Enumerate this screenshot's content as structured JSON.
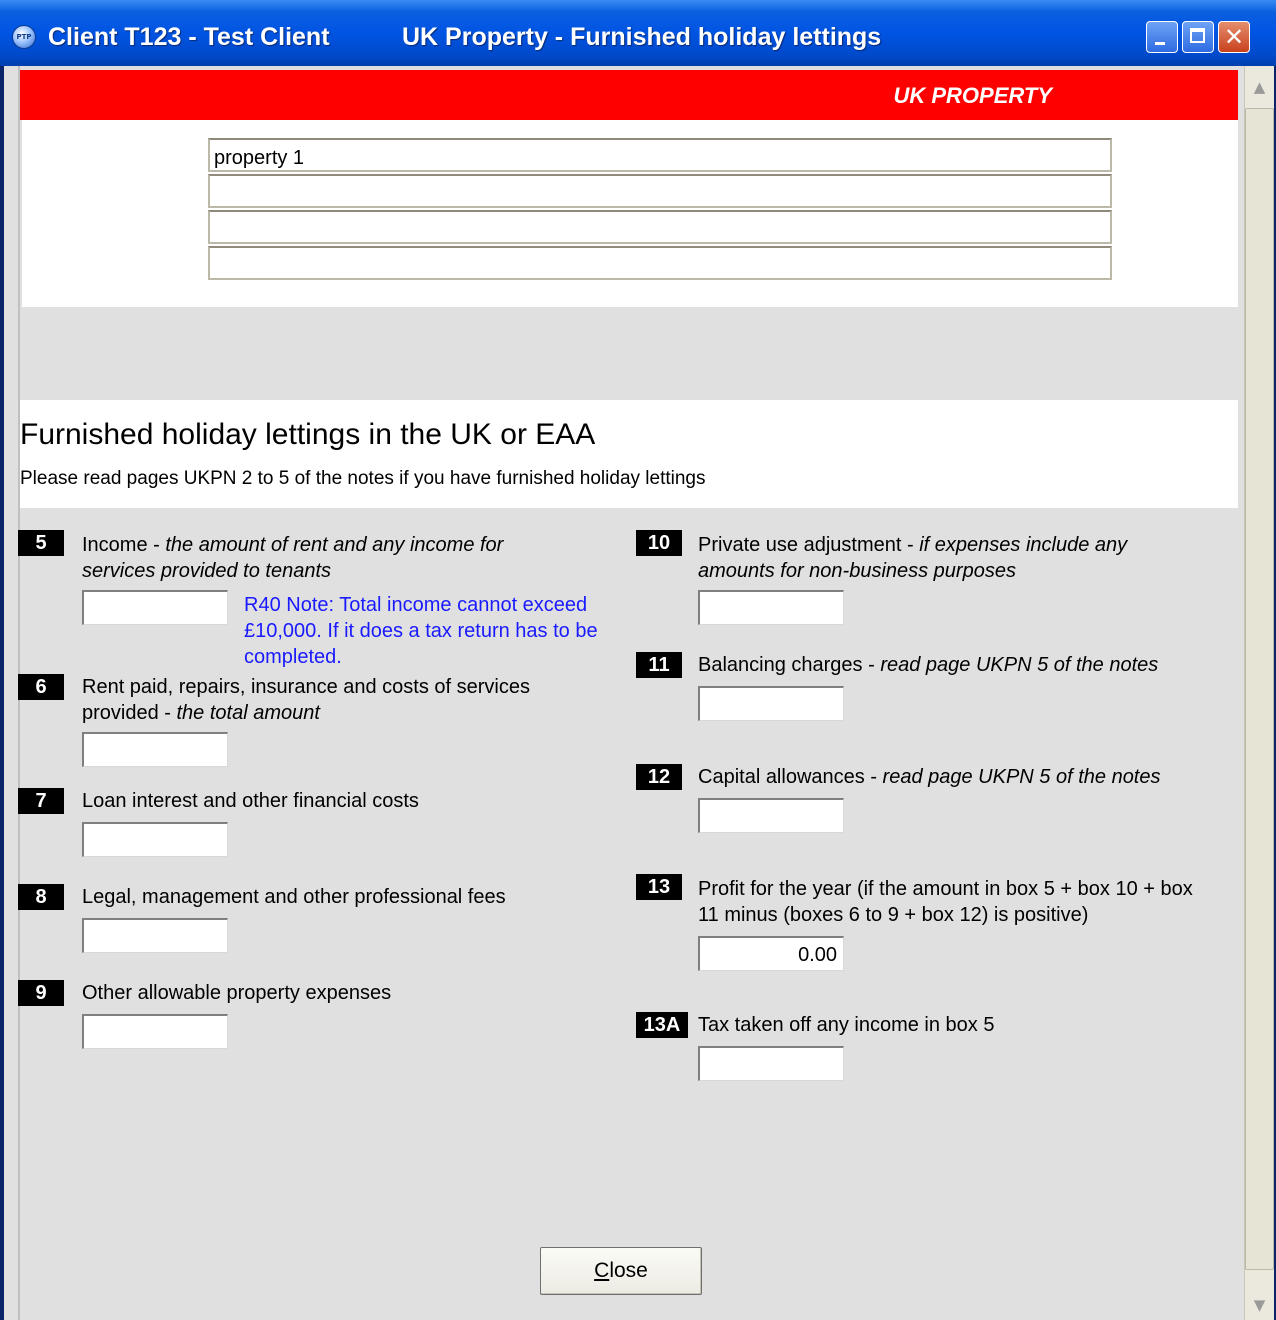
{
  "window": {
    "title_client": "Client T123 - Test Client",
    "title_section": "UK Property - Furnished holiday lettings",
    "app_icon_text": "PTP",
    "minimize_glyph": "",
    "close_glyph": "✕"
  },
  "banner": {
    "label": "UK PROPERTY"
  },
  "properties": [
    "property 1",
    "",
    "",
    ""
  ],
  "heading": "Furnished holiday lettings in the UK or EAA",
  "subheading": "Please read pages UKPN 2 to 5 of the notes if you have furnished holiday lettings",
  "boxes": {
    "b5": {
      "num": "5",
      "label": "Income - ",
      "italic": "the amount of rent and any income for services provided to tenants",
      "value": ""
    },
    "b6": {
      "num": "6",
      "label": "Rent paid, repairs, insurance and costs of services provided - ",
      "italic": "the total amount",
      "value": ""
    },
    "b7": {
      "num": "7",
      "label": "Loan interest and other financial costs",
      "value": ""
    },
    "b8": {
      "num": "8",
      "label": "Legal, management and other professional fees",
      "value": ""
    },
    "b9": {
      "num": "9",
      "label": "Other allowable property expenses",
      "value": ""
    },
    "b10": {
      "num": "10",
      "label": "Private use adjustment - ",
      "italic": "if expenses include any amounts for non-business purposes",
      "value": ""
    },
    "b11": {
      "num": "11",
      "label": "Balancing charges - ",
      "italic": "read page UKPN 5 of the notes",
      "value": ""
    },
    "b12": {
      "num": "12",
      "label": "Capital allowances - ",
      "italic": "read page UKPN 5 of the notes",
      "value": ""
    },
    "b13": {
      "num": "13",
      "label": "Profit for the year (if the amount in box 5 + box 10 + box 11 minus (boxes 6 to 9 + box 12) is positive)",
      "value": "0.00"
    },
    "b13a": {
      "num": "13A",
      "label": "Tax taken off any income in box 5",
      "value": ""
    }
  },
  "note": "R40 Note: Total income cannot exceed £10,000. If it does a tax return has to be completed.",
  "buttons": {
    "close_first": "C",
    "close_rest": "lose"
  },
  "scrollbar": {
    "up_icon": "scroll-up-icon",
    "down_icon": "scroll-down-icon"
  },
  "colors": {
    "titlebar": "#0054e3",
    "banner": "#ff0000",
    "note": "#1a1aff",
    "panel": "#e0e0e0"
  }
}
